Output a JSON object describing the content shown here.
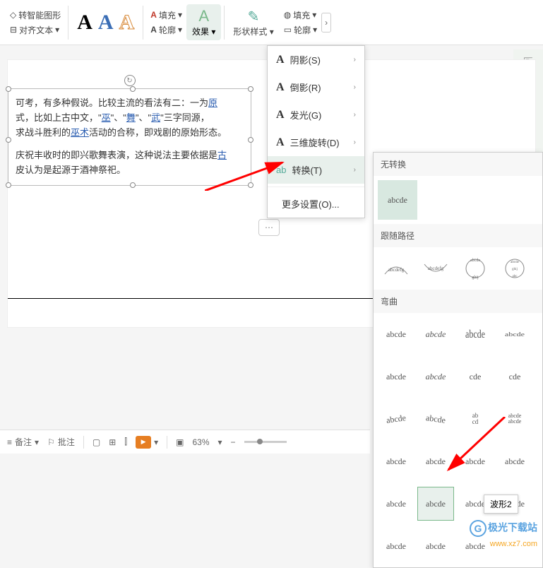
{
  "toolbar": {
    "convertShape": "转智能图形",
    "alignText": "对齐文本",
    "fillA": "填充",
    "outlineA": "轮廓",
    "effect": "效果",
    "shapeStyle": "形状样式",
    "fillShape": "填充",
    "outlineShape": "轮廓"
  },
  "dropdown": {
    "shadow": "阴影(S)",
    "reflection": "倒影(R)",
    "glow": "发光(G)",
    "rotation3d": "三维旋转(D)",
    "transform": "转换(T)",
    "moreSettings": "更多设置(O)..."
  },
  "submenu": {
    "noTransform": "无转换",
    "followPath": "跟随路径",
    "warp": "弯曲",
    "sample": "abcde"
  },
  "tooltip": "波形2",
  "text": {
    "p1a": "可考，有多种假说。比较主流的看法有二：一为",
    "p1link": "原",
    "p2a": "式，比如上古中文，\"",
    "p2l1": "巫",
    "p2b": "\"、\"",
    "p2l2": "舞",
    "p2c": "\"、\"",
    "p2l3": "武",
    "p2d": "\"三字同源，",
    "p3a": "求战斗胜利的",
    "p3l": "巫术",
    "p3b": "活动的合称，即戏剧的原始形态。",
    "p4a": "庆祝丰收时的即兴歌舞表演，这种说法主要依据是",
    "p4l": "古",
    "p5a": "皮认为是起源于酒神祭祀。"
  },
  "statusbar": {
    "notes": "备注",
    "comments": "批注",
    "zoom": "63%"
  },
  "watermark": {
    "title": "极光下载站",
    "url": "www.xz7.com"
  }
}
